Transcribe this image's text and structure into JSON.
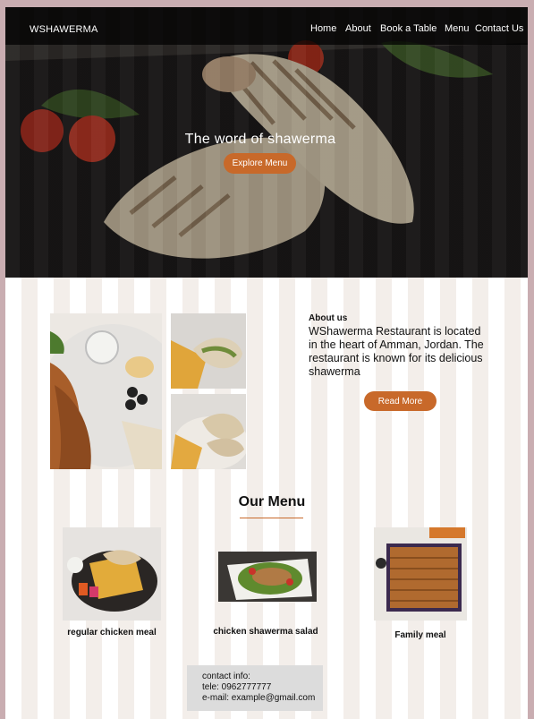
{
  "brand": "WSHAWERMA",
  "nav": {
    "home": "Home",
    "about": "About",
    "book": "Book a Table",
    "menu": "Menu",
    "contact": "Contact Us"
  },
  "hero": {
    "title": "The word of shawerma",
    "button": "Explore Menu"
  },
  "about": {
    "heading": "About us",
    "text": "WShawerma Restaurant is located in the heart of Amman, Jordan. The restaurant is known for its delicious   shawerma",
    "button": "Read More"
  },
  "menu": {
    "title": "Our Menu",
    "items": [
      {
        "name": "regular chicken meal"
      },
      {
        "name": "chicken shawerma salad"
      },
      {
        "name": "Family meal"
      }
    ]
  },
  "contact": {
    "title": "contact info:",
    "phone": "tele: 0962777777",
    "email": "e-mail: example@gmail.com"
  },
  "colors": {
    "accent": "#c8692a",
    "nav_bg": "#000000",
    "page_bg": "#ffffff",
    "stripe": "#f3eeea",
    "frame": "#c9adb1"
  }
}
